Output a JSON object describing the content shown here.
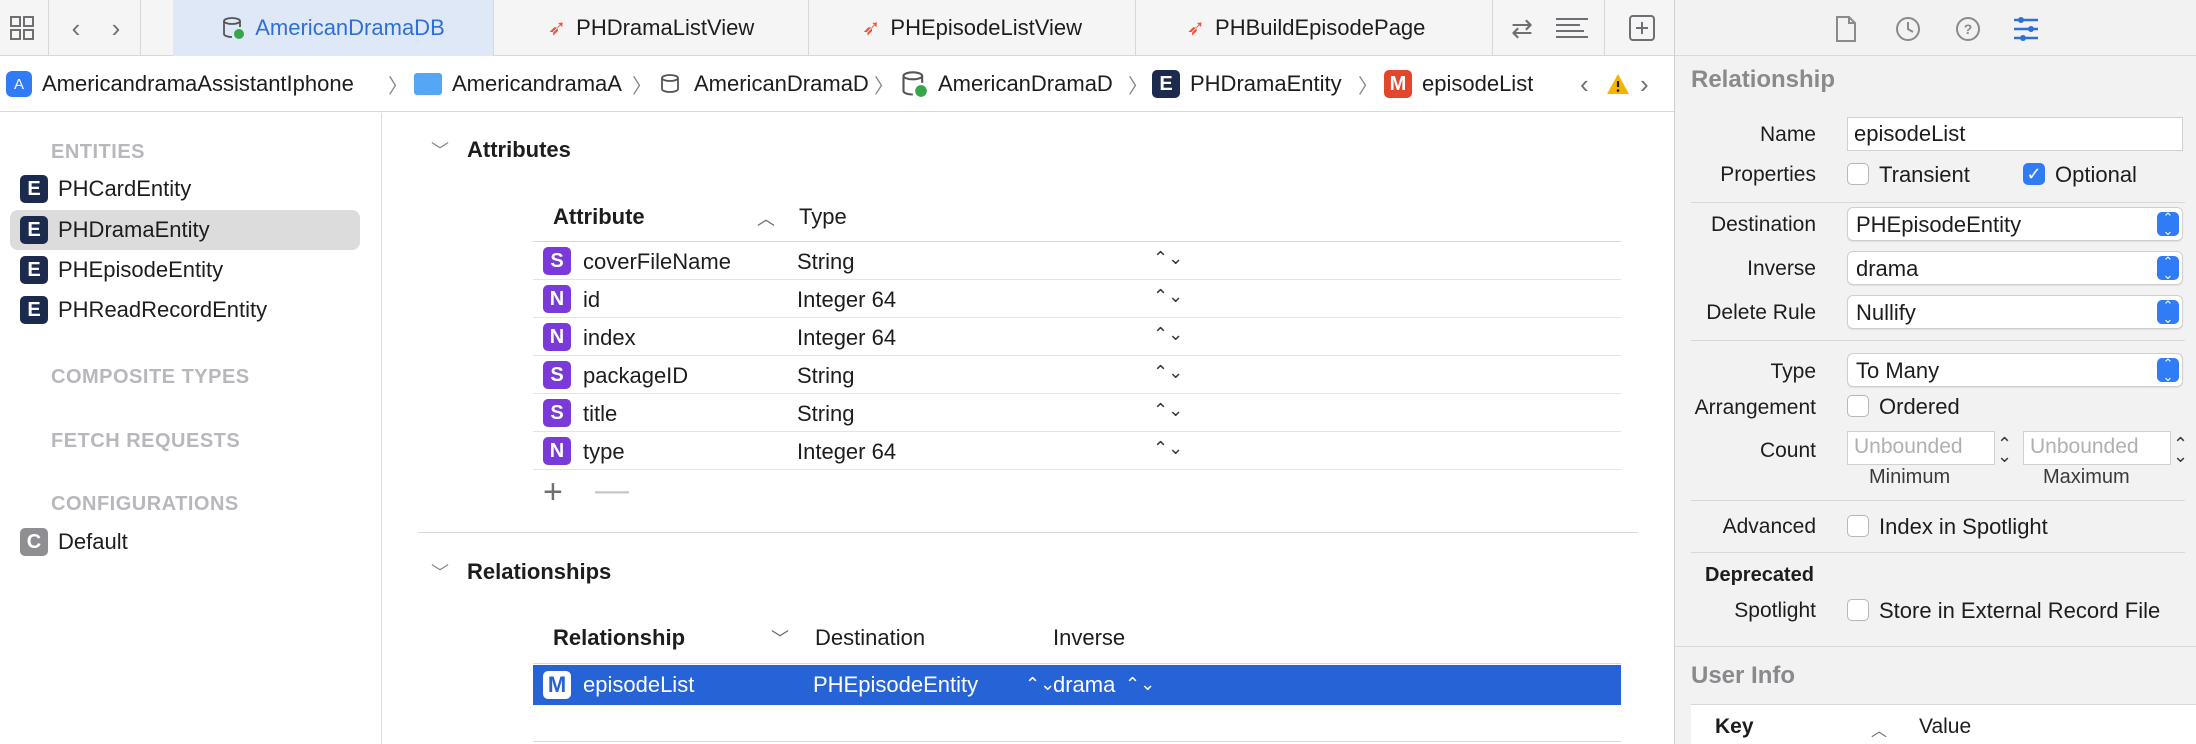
{
  "tabs": [
    {
      "label": "AmericanDramaDB",
      "icon": "database-icon",
      "active": true
    },
    {
      "label": "PHDramaListView",
      "icon": "swift-icon",
      "active": false
    },
    {
      "label": "PHEpisodeListView",
      "icon": "swift-icon",
      "active": false
    },
    {
      "label": "PHBuildEpisodePage",
      "icon": "swift-icon",
      "active": false
    }
  ],
  "breadcrumb": [
    {
      "label": "AmericandramaAssistantIphone",
      "icon": "app-icon"
    },
    {
      "label": "AmericandramaA",
      "icon": "folder-icon"
    },
    {
      "label": "AmericanDramaD",
      "icon": "model-group-icon"
    },
    {
      "label": "AmericanDramaD",
      "icon": "database-icon"
    },
    {
      "label": "PHDramaEntity",
      "badge": "E"
    },
    {
      "label": "episodeList",
      "badge": "M"
    }
  ],
  "sidebar": {
    "entities_header": "ENTITIES",
    "entities": [
      {
        "badge": "E",
        "label": "PHCardEntity"
      },
      {
        "badge": "E",
        "label": "PHDramaEntity",
        "selected": true
      },
      {
        "badge": "E",
        "label": "PHEpisodeEntity"
      },
      {
        "badge": "E",
        "label": "PHReadRecordEntity"
      }
    ],
    "composite_header": "COMPOSITE TYPES",
    "fetch_header": "FETCH REQUESTS",
    "config_header": "CONFIGURATIONS",
    "configurations": [
      {
        "badge": "C",
        "label": "Default"
      }
    ]
  },
  "attributes": {
    "title": "Attributes",
    "col_attribute": "Attribute",
    "col_type": "Type",
    "rows": [
      {
        "badge": "S",
        "name": "coverFileName",
        "type": "String"
      },
      {
        "badge": "N",
        "name": "id",
        "type": "Integer 64"
      },
      {
        "badge": "N",
        "name": "index",
        "type": "Integer 64"
      },
      {
        "badge": "S",
        "name": "packageID",
        "type": "String"
      },
      {
        "badge": "S",
        "name": "title",
        "type": "String"
      },
      {
        "badge": "N",
        "name": "type",
        "type": "Integer 64"
      }
    ]
  },
  "relationships": {
    "title": "Relationships",
    "col_relationship": "Relationship",
    "col_destination": "Destination",
    "col_inverse": "Inverse",
    "rows": [
      {
        "badge": "M",
        "name": "episodeList",
        "destination": "PHEpisodeEntity",
        "inverse": "drama",
        "selected": true
      }
    ]
  },
  "inspector": {
    "title": "Relationship",
    "name_label": "Name",
    "name_value": "episodeList",
    "properties_label": "Properties",
    "transient_label": "Transient",
    "transient_checked": false,
    "optional_label": "Optional",
    "optional_checked": true,
    "destination_label": "Destination",
    "destination_value": "PHEpisodeEntity",
    "inverse_label": "Inverse",
    "inverse_value": "drama",
    "delete_rule_label": "Delete Rule",
    "delete_rule_value": "Nullify",
    "type_label": "Type",
    "type_value": "To Many",
    "arrangement_label": "Arrangement",
    "ordered_label": "Ordered",
    "count_label": "Count",
    "min_placeholder": "Unbounded",
    "max_placeholder": "Unbounded",
    "minimum_label": "Minimum",
    "maximum_label": "Maximum",
    "advanced_label": "Advanced",
    "index_spotlight_label": "Index in Spotlight",
    "deprecated_label": "Deprecated",
    "spotlight_label": "Spotlight",
    "store_external_label": "Store in External Record File",
    "user_info_title": "User Info",
    "key_header": "Key",
    "value_header": "Value"
  },
  "colors": {
    "accent": "#2563d6",
    "entity_badge": "#1c2a4d",
    "string_badge": "#7a3ad8",
    "relationship_badge": "#e2472c",
    "swift": "#f05138"
  }
}
